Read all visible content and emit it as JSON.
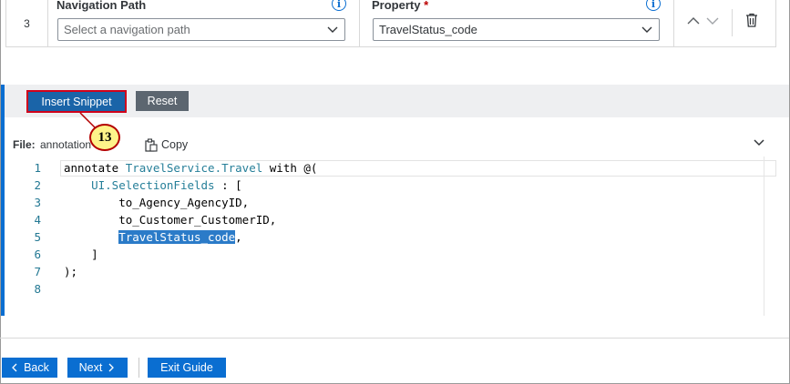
{
  "row": {
    "number": "3",
    "navigation": {
      "label": "Navigation Path",
      "placeholder": "Select a navigation path"
    },
    "property": {
      "label": "Property",
      "required_mark": "*",
      "value": "TravelStatus_code"
    }
  },
  "snippet_toolbar": {
    "insert_label": "Insert Snippet",
    "reset_label": "Reset"
  },
  "callout": {
    "step": "13"
  },
  "file": {
    "label": "File:",
    "name": "annotation",
    "copy_label": "Copy"
  },
  "code": {
    "lines": [
      {
        "n": "1",
        "text": "annotate TravelService.Travel with @("
      },
      {
        "n": "2",
        "text": "    UI.SelectionFields : ["
      },
      {
        "n": "3",
        "text": "        to_Agency_AgencyID,"
      },
      {
        "n": "4",
        "text": "        to_Customer_CustomerID,"
      },
      {
        "n": "5",
        "text": "        TravelStatus_code,"
      },
      {
        "n": "6",
        "text": "    ]"
      },
      {
        "n": "7",
        "text": ");"
      },
      {
        "n": "8",
        "text": ""
      }
    ],
    "selected_token": "TravelStatus_code"
  },
  "footer": {
    "back_label": "Back",
    "next_label": "Next",
    "exit_label": "Exit Guide"
  },
  "colors": {
    "accent": "#0a6ed1",
    "highlight": "#d0021b",
    "callout_fill": "#fef38a"
  }
}
